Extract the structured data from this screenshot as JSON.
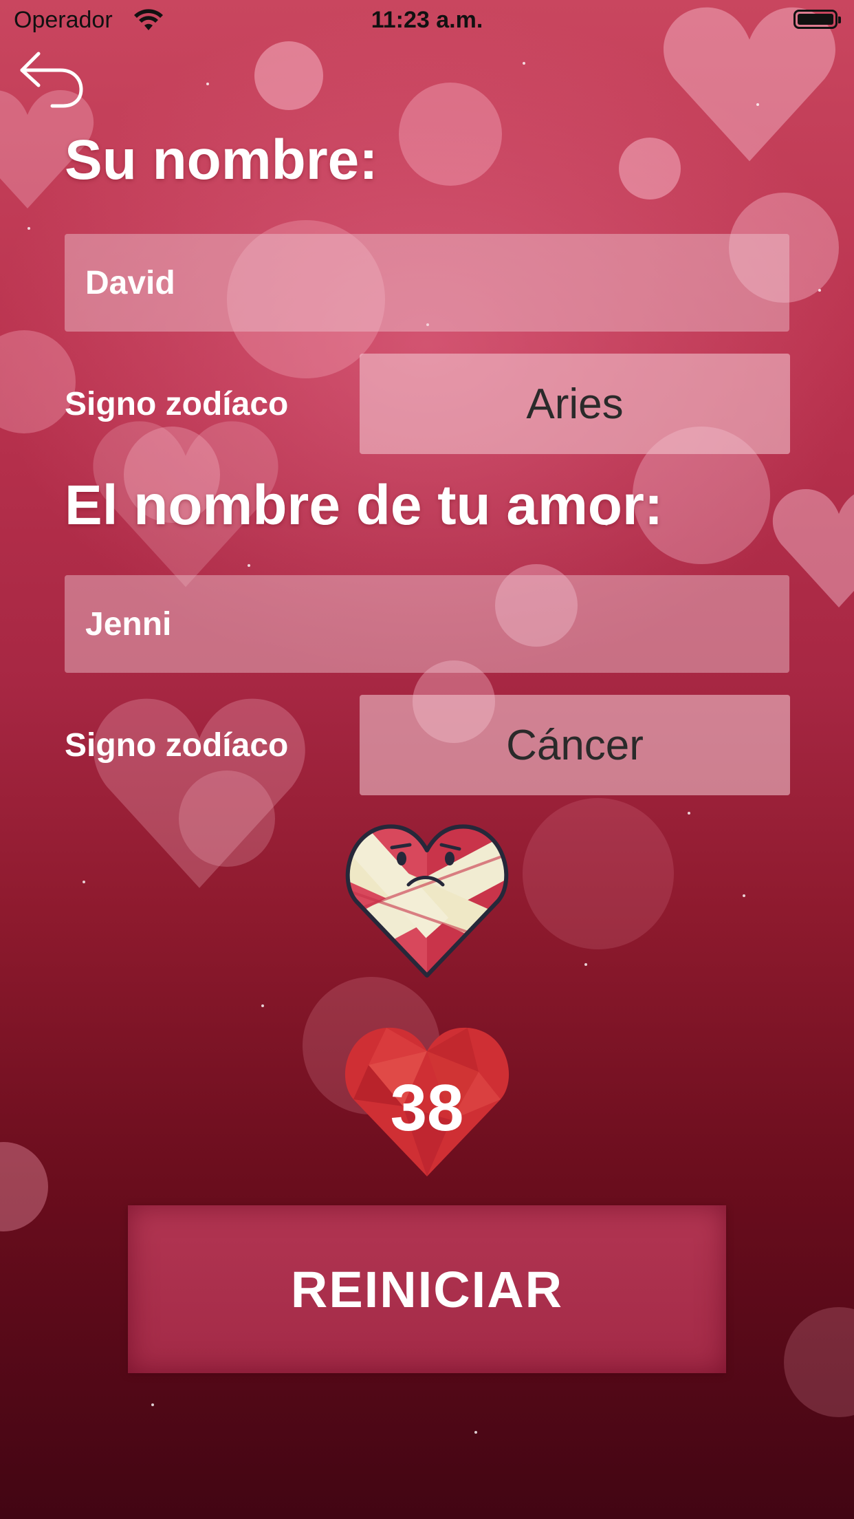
{
  "status_bar": {
    "carrier": "Operador",
    "time": "11:23 a.m."
  },
  "nav": {
    "back_icon": "back-arrow-icon"
  },
  "your": {
    "heading": "Su nombre:",
    "name_value": "David",
    "zodiac_label": "Signo zodíaco",
    "zodiac_value": "Aries"
  },
  "love": {
    "heading": "El nombre de tu amor:",
    "name_value": "Jenni",
    "zodiac_label": "Signo zodíaco",
    "zodiac_value": "Cáncer"
  },
  "result": {
    "mood_icon": "bandaged-heart-icon",
    "score": "38",
    "score_icon": "red-heart-icon"
  },
  "actions": {
    "reset_label": "REINICIAR"
  },
  "colors": {
    "accent": "#a32a47",
    "background_top": "#c9465f",
    "background_bottom": "#420513"
  }
}
